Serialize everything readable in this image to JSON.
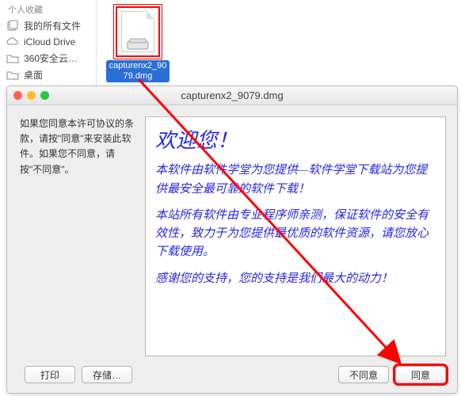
{
  "sidebar": {
    "header": "个人收藏",
    "items": [
      {
        "label": "我的所有文件",
        "icon": "all-files"
      },
      {
        "label": "iCloud Drive",
        "icon": "cloud"
      },
      {
        "label": "360安全云…",
        "icon": "folder"
      },
      {
        "label": "桌面",
        "icon": "folder"
      }
    ]
  },
  "file": {
    "name": "capturenx2_9079.dmg"
  },
  "dialog": {
    "title": "capturenx2_9079.dmg",
    "leftMessage": "如果您同意本许可协议的条款，请按\"同意\"来安装此软件。如果您不同意，请按\"不同意\"。",
    "welcomeHeader": "欢迎您！",
    "p1": "本软件由软件学堂为您提供—软件学堂下载站为您提供最安全最可靠的软件下载！",
    "p2": "本站所有软件由专业程序师亲测，保证软件的安全有效性，致力于为您提供最优质的软件资源，请您放心下载使用。",
    "p3": "感谢您的支持，您的支持是我们最大的动力！",
    "buttons": {
      "print": "打印",
      "save": "存储…",
      "disagree": "不同意",
      "agree": "同意"
    }
  }
}
